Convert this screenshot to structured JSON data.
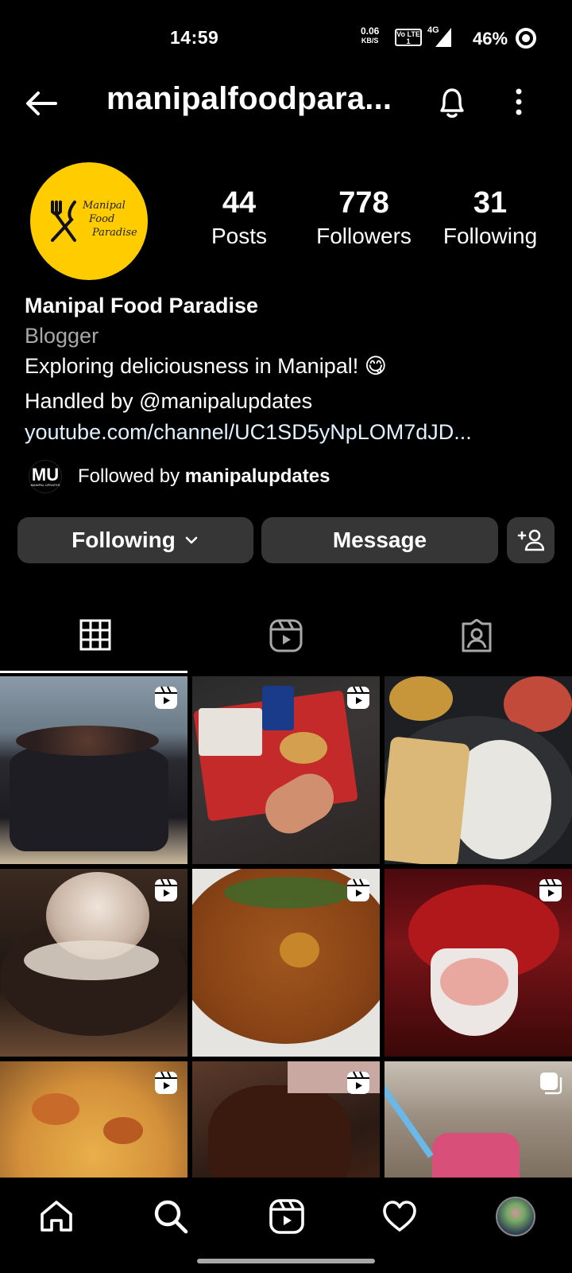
{
  "status_bar": {
    "time": "14:59",
    "speed_value": "0.06",
    "speed_unit": "KB/S",
    "volte": "Vo LTE 1",
    "network": "4G",
    "battery": "46%"
  },
  "header": {
    "username": "manipalfoodpara...",
    "back_icon": "arrow-left-icon",
    "bell_icon": "bell-icon",
    "more_icon": "more-vertical-icon"
  },
  "profile": {
    "avatar_text": [
      "Manipal",
      "Food",
      "Paradise"
    ],
    "stats": [
      {
        "value": "44",
        "label": "Posts"
      },
      {
        "value": "778",
        "label": "Followers"
      },
      {
        "value": "31",
        "label": "Following"
      }
    ],
    "name": "Manipal Food Paradise",
    "category": "Blogger",
    "bio_line1": "Exploring deliciousness in Manipal! 😋",
    "bio_line2": "Handled by @manipalupdates",
    "link": "youtube.com/channel/UC1SD5yNpLOM7dJD...",
    "followed_by_prefix": "Followed by ",
    "followed_by_user": "manipalupdates",
    "mutual_avatar_text": "MU",
    "mutual_avatar_sub": "MANIPAL UPDATES"
  },
  "actions": {
    "following_label": "Following",
    "message_label": "Message",
    "add_person_icon": "add-person-icon"
  },
  "tabs": [
    {
      "name": "grid-icon",
      "active": true
    },
    {
      "name": "reels-icon",
      "active": false
    },
    {
      "name": "tagged-icon",
      "active": false
    }
  ],
  "posts": [
    {
      "subject": "chocolate cake",
      "reel": true
    },
    {
      "subject": "KFC zinger meal",
      "reel": true
    },
    {
      "subject": "rice and papad thali",
      "reel": false
    },
    {
      "subject": "sizzling brownie with ice cream",
      "reel": true
    },
    {
      "subject": "curry bowl",
      "reel": true
    },
    {
      "subject": "pink noodles in cup",
      "reel": true
    },
    {
      "subject": "pizza",
      "reel": true
    },
    {
      "subject": "chilli dish",
      "reel": true
    },
    {
      "subject": "pink drink",
      "reel": false
    }
  ],
  "bottom_nav": [
    "home-icon",
    "search-icon",
    "reels-icon",
    "heart-icon",
    "profile-avatar"
  ],
  "colors": {
    "background": "#000000",
    "button_bg": "#363636",
    "avatar_yellow": "#ffcc00",
    "secondary_text": "#a8a8a8",
    "link_text": "#e0f1ff"
  }
}
